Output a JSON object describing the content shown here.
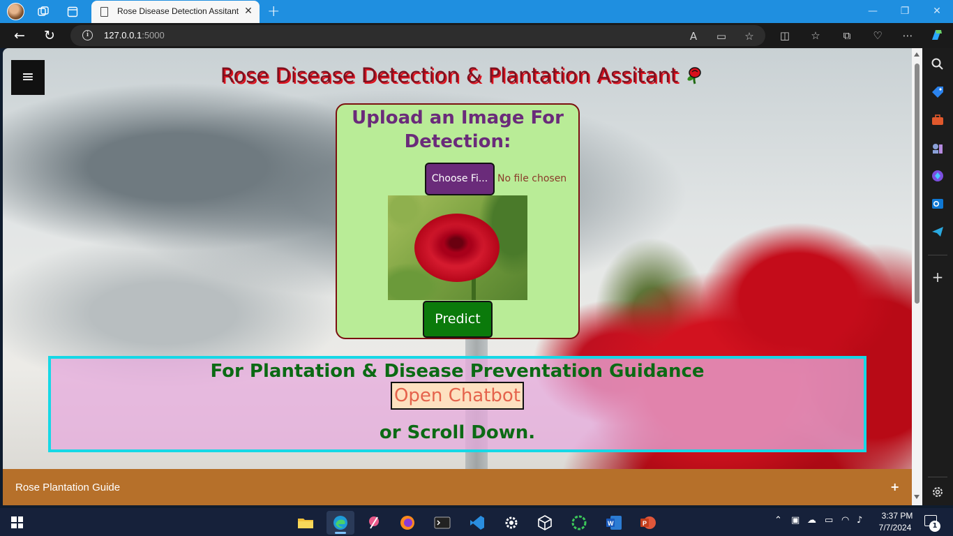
{
  "browser": {
    "tab_title": "Rose Disease Detection Assitant",
    "url_host": "127.0.0.1",
    "url_port": ":5000"
  },
  "page": {
    "menu_icon": "≡",
    "title": "Rose Disease Detection & Plantation Assitant",
    "upload": {
      "heading": "Upload an Image For Detection:",
      "choose_file_label": "Choose Fi...",
      "file_status": "No file chosen",
      "predict_label": "Predict"
    },
    "guidance": {
      "heading": "For Plantation & Disease Preventation Guidance",
      "chatbot_label": "Open Chatbot",
      "scroll_text": "or Scroll Down."
    },
    "accordion": {
      "label": "Rose Plantation Guide",
      "toggle": "+"
    }
  },
  "taskbar": {
    "time": "3:37 PM",
    "date": "7/7/2024",
    "notification_count": "1"
  },
  "colors": {
    "title_bar": "#1f8fe0",
    "card_bg": "#b9ec97",
    "card_heading": "#6a2b7a",
    "predict_bg": "#0b7a0b",
    "guide_border": "#16d8e6",
    "guide_text": "#0b6a14",
    "chatbot_text": "#e5634c",
    "accordion_bg": "#b6702a"
  }
}
